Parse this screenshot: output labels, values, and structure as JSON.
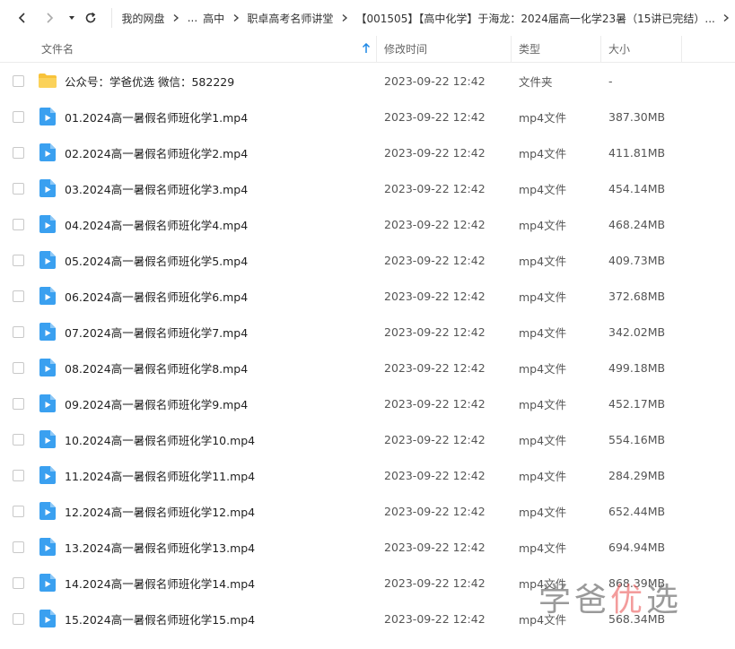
{
  "breadcrumb": {
    "items": [
      "我的网盘",
      "...",
      "高中",
      "职卓高考名师讲堂",
      "【001505】【高中化学】于海龙：2024届高一化学23暑（15讲已完结）..."
    ]
  },
  "table": {
    "headers": {
      "name": "文件名",
      "time": "修改时间",
      "type": "类型",
      "size": "大小"
    },
    "rows": [
      {
        "icon": "folder-icon",
        "name": "公众号：学爸优选 微信：582229",
        "time": "2023-09-22 12:42",
        "type": "文件夹",
        "size": "-"
      },
      {
        "icon": "video-file-icon",
        "name": "01.2024高一暑假名师班化学1.mp4",
        "time": "2023-09-22 12:42",
        "type": "mp4文件",
        "size": "387.30MB"
      },
      {
        "icon": "video-file-icon",
        "name": "02.2024高一暑假名师班化学2.mp4",
        "time": "2023-09-22 12:42",
        "type": "mp4文件",
        "size": "411.81MB"
      },
      {
        "icon": "video-file-icon",
        "name": "03.2024高一暑假名师班化学3.mp4",
        "time": "2023-09-22 12:42",
        "type": "mp4文件",
        "size": "454.14MB"
      },
      {
        "icon": "video-file-icon",
        "name": "04.2024高一暑假名师班化学4.mp4",
        "time": "2023-09-22 12:42",
        "type": "mp4文件",
        "size": "468.24MB"
      },
      {
        "icon": "video-file-icon",
        "name": "05.2024高一暑假名师班化学5.mp4",
        "time": "2023-09-22 12:42",
        "type": "mp4文件",
        "size": "409.73MB"
      },
      {
        "icon": "video-file-icon",
        "name": "06.2024高一暑假名师班化学6.mp4",
        "time": "2023-09-22 12:42",
        "type": "mp4文件",
        "size": "372.68MB"
      },
      {
        "icon": "video-file-icon",
        "name": "07.2024高一暑假名师班化学7.mp4",
        "time": "2023-09-22 12:42",
        "type": "mp4文件",
        "size": "342.02MB"
      },
      {
        "icon": "video-file-icon",
        "name": "08.2024高一暑假名师班化学8.mp4",
        "time": "2023-09-22 12:42",
        "type": "mp4文件",
        "size": "499.18MB"
      },
      {
        "icon": "video-file-icon",
        "name": "09.2024高一暑假名师班化学9.mp4",
        "time": "2023-09-22 12:42",
        "type": "mp4文件",
        "size": "452.17MB"
      },
      {
        "icon": "video-file-icon",
        "name": "10.2024高一暑假名师班化学10.mp4",
        "time": "2023-09-22 12:42",
        "type": "mp4文件",
        "size": "554.16MB"
      },
      {
        "icon": "video-file-icon",
        "name": "11.2024高一暑假名师班化学11.mp4",
        "time": "2023-09-22 12:42",
        "type": "mp4文件",
        "size": "284.29MB"
      },
      {
        "icon": "video-file-icon",
        "name": "12.2024高一暑假名师班化学12.mp4",
        "time": "2023-09-22 12:42",
        "type": "mp4文件",
        "size": "652.44MB"
      },
      {
        "icon": "video-file-icon",
        "name": "13.2024高一暑假名师班化学13.mp4",
        "time": "2023-09-22 12:42",
        "type": "mp4文件",
        "size": "694.94MB"
      },
      {
        "icon": "video-file-icon",
        "name": "14.2024高一暑假名师班化学14.mp4",
        "time": "2023-09-22 12:42",
        "type": "mp4文件",
        "size": "868.39MB"
      },
      {
        "icon": "video-file-icon",
        "name": "15.2024高一暑假名师班化学15.mp4",
        "time": "2023-09-22 12:42",
        "type": "mp4文件",
        "size": "568.34MB"
      }
    ]
  },
  "watermark": {
    "part1": "学爸",
    "part2": "优",
    "part3": "选"
  },
  "colors": {
    "folder": "#f8c33a",
    "video": "#3aa0f0",
    "accent": "#1e88e5"
  }
}
